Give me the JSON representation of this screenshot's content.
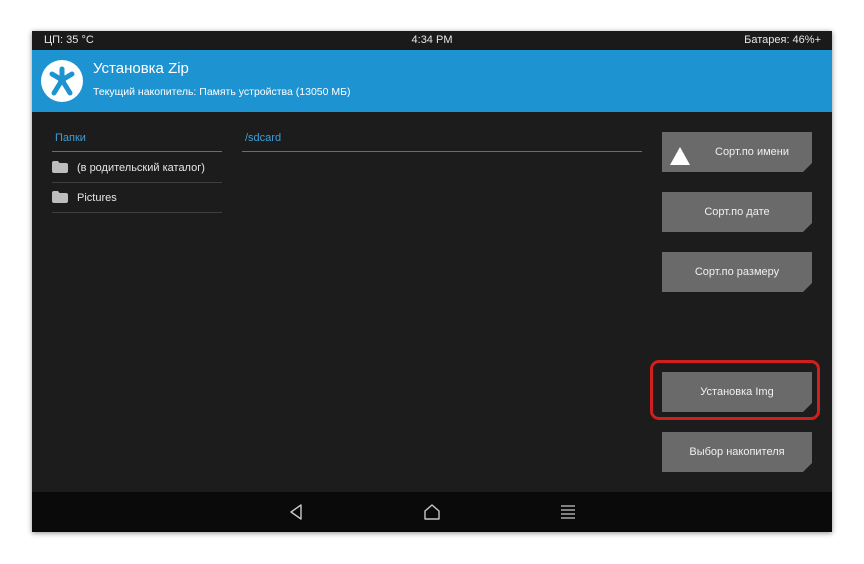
{
  "status_bar": {
    "cpu": "ЦП: 35 °C",
    "time": "4:34 PM",
    "battery": "Батарея: 46%+"
  },
  "header": {
    "title": "Установка Zip",
    "subtitle": "Текущий накопитель: Память устройства (13050 МБ)",
    "logo_icon": "twrp-logo-icon"
  },
  "folders": {
    "header": "Папки",
    "items": [
      {
        "label": "(в родительский каталог)",
        "icon": "folder-icon"
      },
      {
        "label": "Pictures",
        "icon": "folder-icon"
      }
    ]
  },
  "files": {
    "path": "/sdcard"
  },
  "buttons": {
    "sort_name": "Сорт.по имени",
    "sort_date": "Сорт.по дате",
    "sort_size": "Сорт.по размеру",
    "install_img": "Установка Img",
    "select_storage": "Выбор накопителя"
  },
  "navbar": {
    "back_icon": "back-triangle-icon",
    "home_icon": "home-icon",
    "menu_icon": "menu-lines-icon"
  },
  "colors": {
    "header_bg": "#1e93d2",
    "accent": "#3d9fd6",
    "button_bg": "#6a6a6a",
    "highlight": "#d0201e",
    "background": "#1c1c1c"
  }
}
